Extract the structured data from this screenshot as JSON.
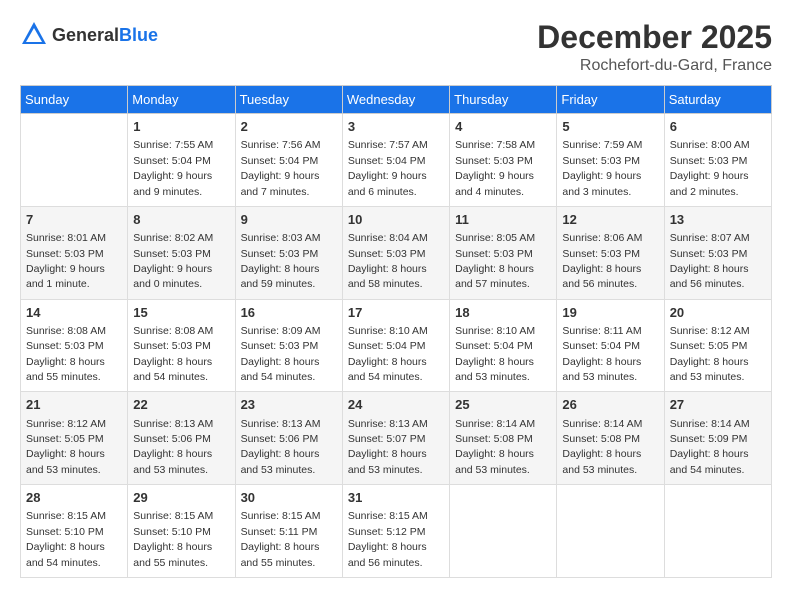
{
  "header": {
    "logo_general": "General",
    "logo_blue": "Blue",
    "month_year": "December 2025",
    "location": "Rochefort-du-Gard, France"
  },
  "days_of_week": [
    "Sunday",
    "Monday",
    "Tuesday",
    "Wednesday",
    "Thursday",
    "Friday",
    "Saturday"
  ],
  "weeks": [
    [
      {
        "day": "",
        "sunrise": "",
        "sunset": "",
        "daylight": ""
      },
      {
        "day": "1",
        "sunrise": "Sunrise: 7:55 AM",
        "sunset": "Sunset: 5:04 PM",
        "daylight": "Daylight: 9 hours and 9 minutes."
      },
      {
        "day": "2",
        "sunrise": "Sunrise: 7:56 AM",
        "sunset": "Sunset: 5:04 PM",
        "daylight": "Daylight: 9 hours and 7 minutes."
      },
      {
        "day": "3",
        "sunrise": "Sunrise: 7:57 AM",
        "sunset": "Sunset: 5:04 PM",
        "daylight": "Daylight: 9 hours and 6 minutes."
      },
      {
        "day": "4",
        "sunrise": "Sunrise: 7:58 AM",
        "sunset": "Sunset: 5:03 PM",
        "daylight": "Daylight: 9 hours and 4 minutes."
      },
      {
        "day": "5",
        "sunrise": "Sunrise: 7:59 AM",
        "sunset": "Sunset: 5:03 PM",
        "daylight": "Daylight: 9 hours and 3 minutes."
      },
      {
        "day": "6",
        "sunrise": "Sunrise: 8:00 AM",
        "sunset": "Sunset: 5:03 PM",
        "daylight": "Daylight: 9 hours and 2 minutes."
      }
    ],
    [
      {
        "day": "7",
        "sunrise": "Sunrise: 8:01 AM",
        "sunset": "Sunset: 5:03 PM",
        "daylight": "Daylight: 9 hours and 1 minute."
      },
      {
        "day": "8",
        "sunrise": "Sunrise: 8:02 AM",
        "sunset": "Sunset: 5:03 PM",
        "daylight": "Daylight: 9 hours and 0 minutes."
      },
      {
        "day": "9",
        "sunrise": "Sunrise: 8:03 AM",
        "sunset": "Sunset: 5:03 PM",
        "daylight": "Daylight: 8 hours and 59 minutes."
      },
      {
        "day": "10",
        "sunrise": "Sunrise: 8:04 AM",
        "sunset": "Sunset: 5:03 PM",
        "daylight": "Daylight: 8 hours and 58 minutes."
      },
      {
        "day": "11",
        "sunrise": "Sunrise: 8:05 AM",
        "sunset": "Sunset: 5:03 PM",
        "daylight": "Daylight: 8 hours and 57 minutes."
      },
      {
        "day": "12",
        "sunrise": "Sunrise: 8:06 AM",
        "sunset": "Sunset: 5:03 PM",
        "daylight": "Daylight: 8 hours and 56 minutes."
      },
      {
        "day": "13",
        "sunrise": "Sunrise: 8:07 AM",
        "sunset": "Sunset: 5:03 PM",
        "daylight": "Daylight: 8 hours and 56 minutes."
      }
    ],
    [
      {
        "day": "14",
        "sunrise": "Sunrise: 8:08 AM",
        "sunset": "Sunset: 5:03 PM",
        "daylight": "Daylight: 8 hours and 55 minutes."
      },
      {
        "day": "15",
        "sunrise": "Sunrise: 8:08 AM",
        "sunset": "Sunset: 5:03 PM",
        "daylight": "Daylight: 8 hours and 54 minutes."
      },
      {
        "day": "16",
        "sunrise": "Sunrise: 8:09 AM",
        "sunset": "Sunset: 5:03 PM",
        "daylight": "Daylight: 8 hours and 54 minutes."
      },
      {
        "day": "17",
        "sunrise": "Sunrise: 8:10 AM",
        "sunset": "Sunset: 5:04 PM",
        "daylight": "Daylight: 8 hours and 54 minutes."
      },
      {
        "day": "18",
        "sunrise": "Sunrise: 8:10 AM",
        "sunset": "Sunset: 5:04 PM",
        "daylight": "Daylight: 8 hours and 53 minutes."
      },
      {
        "day": "19",
        "sunrise": "Sunrise: 8:11 AM",
        "sunset": "Sunset: 5:04 PM",
        "daylight": "Daylight: 8 hours and 53 minutes."
      },
      {
        "day": "20",
        "sunrise": "Sunrise: 8:12 AM",
        "sunset": "Sunset: 5:05 PM",
        "daylight": "Daylight: 8 hours and 53 minutes."
      }
    ],
    [
      {
        "day": "21",
        "sunrise": "Sunrise: 8:12 AM",
        "sunset": "Sunset: 5:05 PM",
        "daylight": "Daylight: 8 hours and 53 minutes."
      },
      {
        "day": "22",
        "sunrise": "Sunrise: 8:13 AM",
        "sunset": "Sunset: 5:06 PM",
        "daylight": "Daylight: 8 hours and 53 minutes."
      },
      {
        "day": "23",
        "sunrise": "Sunrise: 8:13 AM",
        "sunset": "Sunset: 5:06 PM",
        "daylight": "Daylight: 8 hours and 53 minutes."
      },
      {
        "day": "24",
        "sunrise": "Sunrise: 8:13 AM",
        "sunset": "Sunset: 5:07 PM",
        "daylight": "Daylight: 8 hours and 53 minutes."
      },
      {
        "day": "25",
        "sunrise": "Sunrise: 8:14 AM",
        "sunset": "Sunset: 5:08 PM",
        "daylight": "Daylight: 8 hours and 53 minutes."
      },
      {
        "day": "26",
        "sunrise": "Sunrise: 8:14 AM",
        "sunset": "Sunset: 5:08 PM",
        "daylight": "Daylight: 8 hours and 53 minutes."
      },
      {
        "day": "27",
        "sunrise": "Sunrise: 8:14 AM",
        "sunset": "Sunset: 5:09 PM",
        "daylight": "Daylight: 8 hours and 54 minutes."
      }
    ],
    [
      {
        "day": "28",
        "sunrise": "Sunrise: 8:15 AM",
        "sunset": "Sunset: 5:10 PM",
        "daylight": "Daylight: 8 hours and 54 minutes."
      },
      {
        "day": "29",
        "sunrise": "Sunrise: 8:15 AM",
        "sunset": "Sunset: 5:10 PM",
        "daylight": "Daylight: 8 hours and 55 minutes."
      },
      {
        "day": "30",
        "sunrise": "Sunrise: 8:15 AM",
        "sunset": "Sunset: 5:11 PM",
        "daylight": "Daylight: 8 hours and 55 minutes."
      },
      {
        "day": "31",
        "sunrise": "Sunrise: 8:15 AM",
        "sunset": "Sunset: 5:12 PM",
        "daylight": "Daylight: 8 hours and 56 minutes."
      },
      {
        "day": "",
        "sunrise": "",
        "sunset": "",
        "daylight": ""
      },
      {
        "day": "",
        "sunrise": "",
        "sunset": "",
        "daylight": ""
      },
      {
        "day": "",
        "sunrise": "",
        "sunset": "",
        "daylight": ""
      }
    ]
  ]
}
